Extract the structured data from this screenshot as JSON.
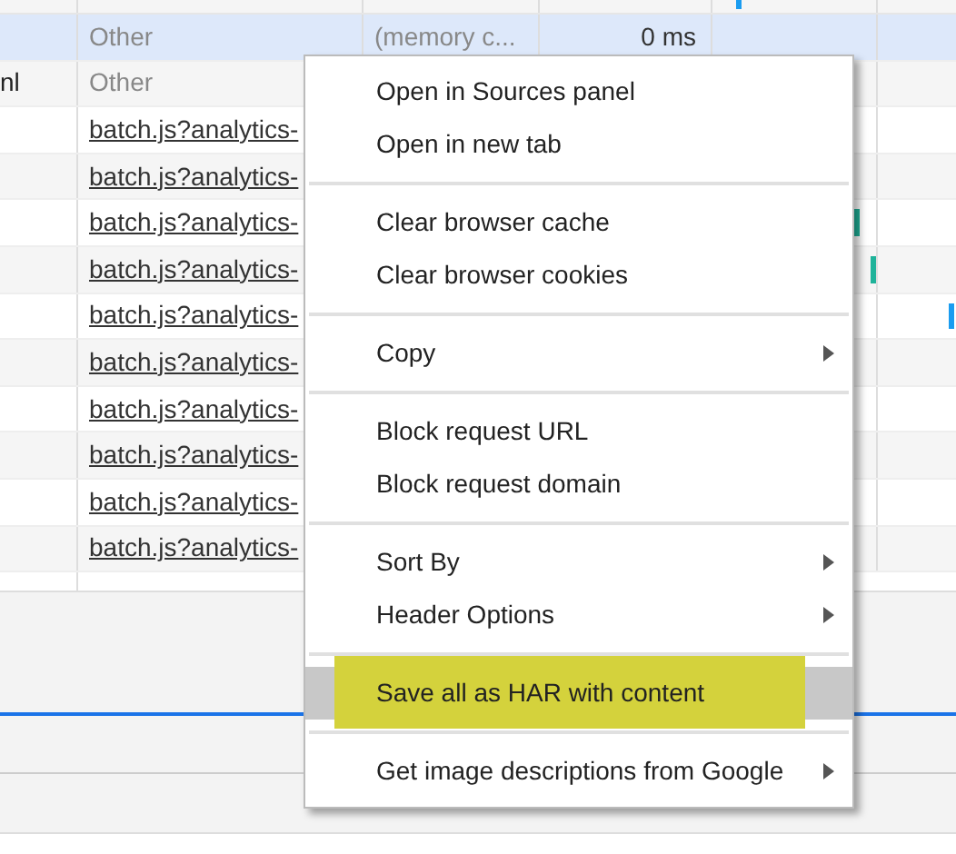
{
  "table": {
    "rows": [
      {
        "name": "",
        "type": "Other",
        "initiator": "(memory c...",
        "time": "0 ms",
        "selected": true
      },
      {
        "name": "nl",
        "type": "Other",
        "selected": false
      },
      {
        "type": "batch.js?analytics-",
        "selected": false,
        "kind": "link"
      },
      {
        "type": "batch.js?analytics-",
        "selected": false,
        "kind": "link"
      },
      {
        "type": "batch.js?analytics-",
        "selected": false,
        "kind": "link"
      },
      {
        "type": "batch.js?analytics-",
        "selected": false,
        "kind": "link"
      },
      {
        "type": "batch.js?analytics-",
        "selected": false,
        "kind": "link"
      },
      {
        "type": "batch.js?analytics-",
        "selected": false,
        "kind": "link"
      },
      {
        "type": "batch.js?analytics-",
        "selected": false,
        "kind": "link"
      },
      {
        "type": "batch.js?analytics-",
        "selected": false,
        "kind": "link"
      },
      {
        "type": "batch.js?analytics-",
        "selected": false,
        "kind": "link"
      },
      {
        "type": "batch.js?analytics-",
        "selected": false,
        "kind": "link"
      }
    ]
  },
  "context_menu": {
    "groups": [
      [
        {
          "label": "Open in Sources panel",
          "submenu": false,
          "selected": false
        },
        {
          "label": "Open in new tab",
          "submenu": false,
          "selected": false
        }
      ],
      [
        {
          "label": "Clear browser cache",
          "submenu": false,
          "selected": false
        },
        {
          "label": "Clear browser cookies",
          "submenu": false,
          "selected": false
        }
      ],
      [
        {
          "label": "Copy",
          "submenu": true,
          "selected": false
        }
      ],
      [
        {
          "label": "Block request URL",
          "submenu": false,
          "selected": false
        },
        {
          "label": "Block request domain",
          "submenu": false,
          "selected": false
        }
      ],
      [
        {
          "label": "Sort By",
          "submenu": true,
          "selected": false
        },
        {
          "label": "Header Options",
          "submenu": true,
          "selected": false
        }
      ],
      [
        {
          "label": "Save all as HAR with content",
          "submenu": false,
          "selected": true,
          "annotated": true
        }
      ],
      [
        {
          "label": "Get image descriptions from Google",
          "submenu": true,
          "selected": false
        }
      ]
    ]
  }
}
